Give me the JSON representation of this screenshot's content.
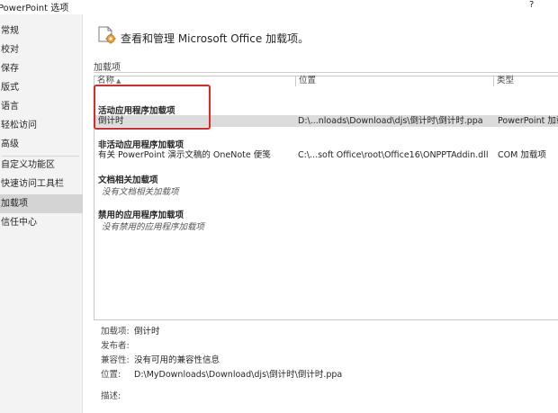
{
  "window": {
    "title": "PowerPoint 选项",
    "help": "?"
  },
  "sidebar": {
    "items": [
      {
        "label": "常规"
      },
      {
        "label": "校对"
      },
      {
        "label": "保存"
      },
      {
        "label": "版式"
      },
      {
        "label": "语言"
      },
      {
        "label": "轻松访问"
      },
      {
        "label": "高级"
      },
      {
        "label": "自定义功能区"
      },
      {
        "label": "快速访问工具栏"
      },
      {
        "label": "加载项",
        "selected": true
      },
      {
        "label": "信任中心"
      }
    ]
  },
  "header": {
    "title": "查看和管理 Microsoft Office 加载项。"
  },
  "addins": {
    "section_title": "加载项",
    "columns": {
      "name": "名称",
      "name_sort": "▲",
      "location": "位置",
      "type": "类型"
    },
    "groups": {
      "active": {
        "title": "活动应用程序加载项",
        "rows": [
          {
            "name": "倒计时",
            "location": "D:\\...nloads\\Download\\djs\\倒计时\\倒计时.ppa",
            "type": "PowerPoint 加载"
          }
        ]
      },
      "inactive": {
        "title": "非活动应用程序加载项",
        "rows": [
          {
            "name": "有关 PowerPoint 演示文稿的 OneNote 便笺",
            "location": "C:\\...soft Office\\root\\Office16\\ONPPTAddin.dll",
            "type": "COM 加载项"
          }
        ]
      },
      "document": {
        "title": "文档相关加载项",
        "empty": "没有文档相关加载项"
      },
      "disabled": {
        "title": "禁用的应用程序加载项",
        "empty": "没有禁用的应用程序加载项"
      }
    }
  },
  "details": {
    "addin_label": "加载项:",
    "addin_value": "倒计时",
    "publisher_label": "发布者:",
    "publisher_value": "",
    "compat_label": "兼容性:",
    "compat_value": "没有可用的兼容性信息",
    "location_label": "位置:",
    "location_value": "D:\\MyDownloads\\Download\\djs\\倒计时\\倒计时.ppa",
    "description_label": "描述:"
  },
  "colors": {
    "highlight": "#e22525",
    "selected_row": "#dcdcdc",
    "sidebar_bg": "#f3f3f3",
    "sidebar_selected": "#d4d4d4"
  }
}
